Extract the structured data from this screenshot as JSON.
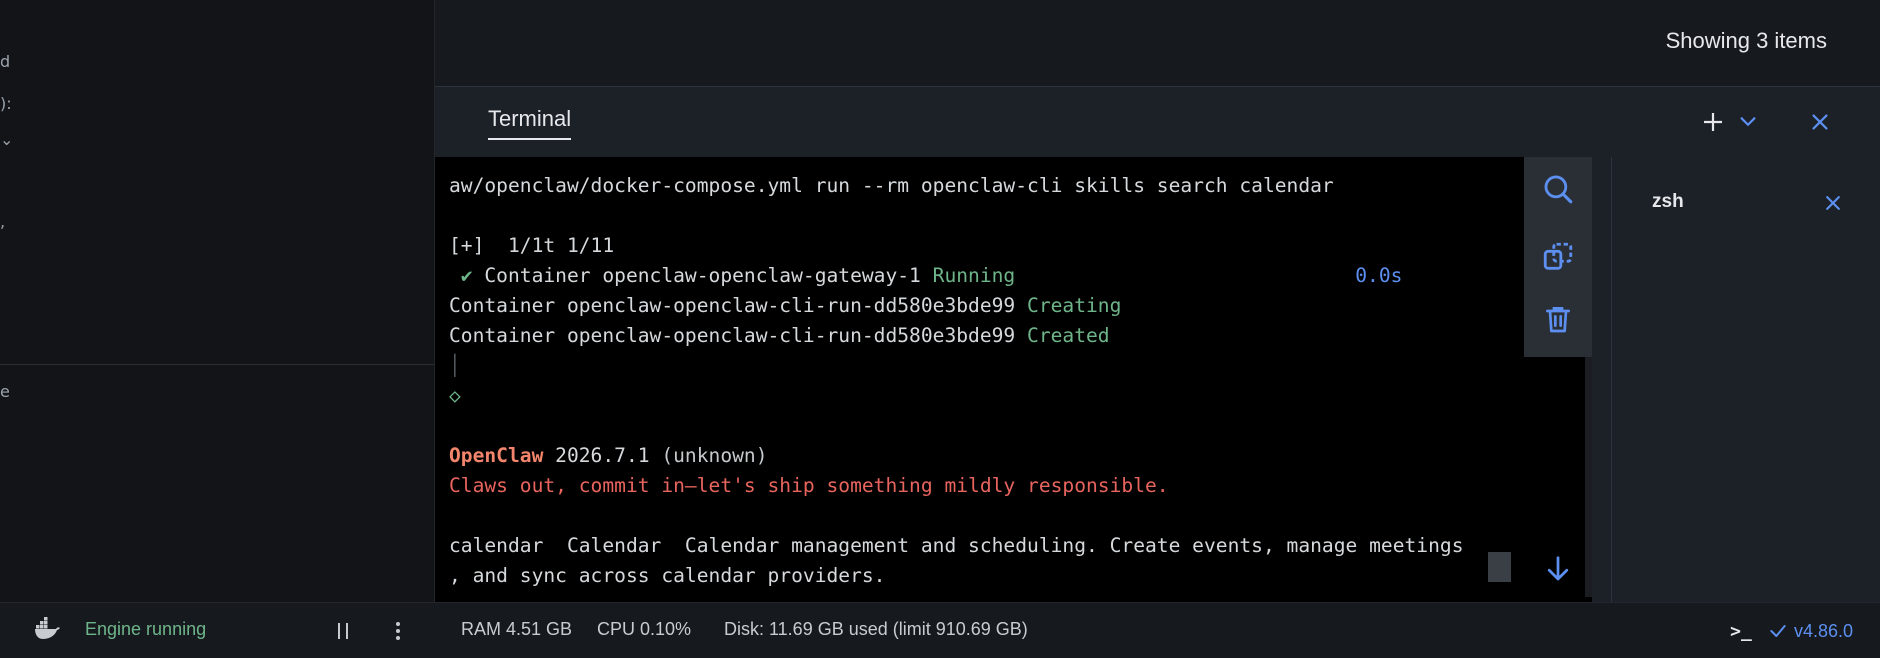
{
  "top": {
    "showing_count": "Showing 3 items"
  },
  "terminal": {
    "tab_label": "Terminal",
    "lines": {
      "cmd": "aw/openclaw/docker-compose.yml run --rm openclaw-cli skills search calendar",
      "progress": "[+]  1/1t 1/11",
      "check": "✔",
      "c1_name": " Container openclaw-openclaw-gateway-1 ",
      "c1_status": "Running",
      "c1_time": "0.0s",
      "c2_name": "Container openclaw-openclaw-cli-run-dd580e3bde99 ",
      "c2_status": "Creating",
      "c3_name": "Container openclaw-openclaw-cli-run-dd580e3bde99 ",
      "c3_status": "Created",
      "pipe": "│",
      "diamond": "◇",
      "brand": "OpenClaw",
      "brand_version": " 2026.7.1 ",
      "brand_note": "(unknown)",
      "tagline": "Claws out, commit in—let's ship something mildly responsible.",
      "result_1": "calendar  Calendar  Calendar management and scheduling. Create events, manage meetings",
      "result_2": ", and sync across calendar providers."
    },
    "sessions": [
      {
        "label": "zsh"
      }
    ]
  },
  "status_bar": {
    "engine_status": "Engine running",
    "ram": "RAM 4.51 GB",
    "cpu": "CPU 0.10%",
    "disk": "Disk: 11.69 GB used (limit 910.69 GB)",
    "terminal_toggle": ">_",
    "version": "v4.86.0"
  },
  "icons": {
    "add": "plus-icon",
    "chevron": "chevron-down-icon",
    "close": "close-icon",
    "search": "search-icon",
    "copy": "copy-icon",
    "trash": "trash-icon",
    "scroll": "arrow-down-icon",
    "whale": "whale-icon",
    "check": "check-icon"
  },
  "colors": {
    "accent": "#5c8ff0",
    "success": "#6fb58a",
    "brand": "#f2856b",
    "tagline": "#e8645e"
  }
}
